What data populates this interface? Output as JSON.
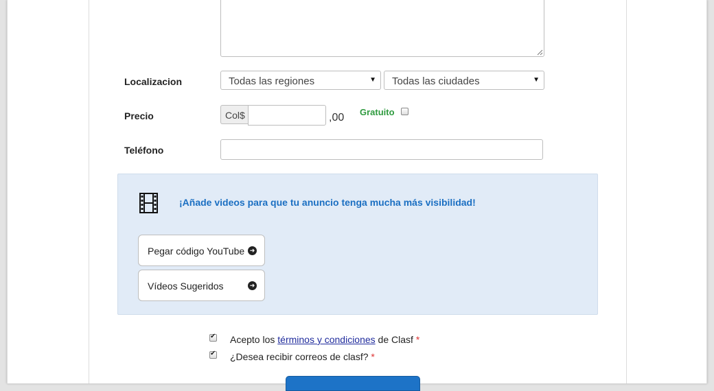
{
  "form": {
    "location": {
      "label": "Localizacion",
      "region_select": "Todas las regiones",
      "city_select": "Todas las ciudades"
    },
    "price": {
      "label": "Precio",
      "currency_prefix": "Col$",
      "value": "",
      "cents_suffix": ",00",
      "free_label": "Gratuito",
      "free_checked": false
    },
    "phone": {
      "label": "Teléfono",
      "value": ""
    }
  },
  "videos": {
    "icon": "film-icon",
    "headline": "¡Añade videos para que tu anuncio tenga mucha más visibilidad!",
    "paste_youtube_label": "Pegar código YouTube",
    "suggested_videos_label": "Vídeos Sugeridos"
  },
  "terms": {
    "accept_prefix": "Acepto los ",
    "terms_link": "términos y condiciones",
    "accept_suffix": " de Clasf",
    "required_mark": "*",
    "accept_checked": true,
    "email_question": "¿Desea recibir correos de clasf?",
    "email_checked": true
  },
  "colors": {
    "accent_blue": "#1b6fc2",
    "free_green": "#2e9a3e",
    "panel_bg": "#e1ebf7",
    "submit_blue": "#1d73c7"
  }
}
